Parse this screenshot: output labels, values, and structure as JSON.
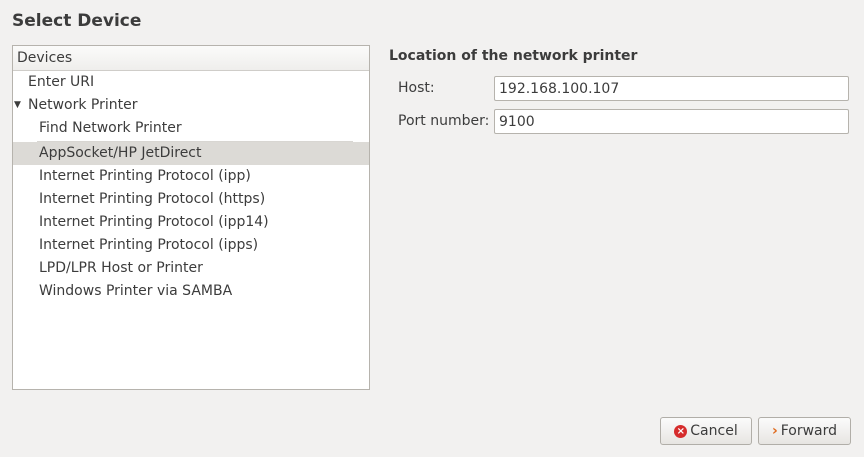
{
  "window": {
    "title": "Select Device"
  },
  "devices": {
    "header": "Devices",
    "items": [
      {
        "label": "Enter URI",
        "level": 0
      },
      {
        "label": "Network Printer",
        "level": 0,
        "expanded": true
      },
      {
        "label": "Find Network Printer",
        "level": 1
      },
      {
        "label": "AppSocket/HP JetDirect",
        "level": 1,
        "selected": true
      },
      {
        "label": "Internet Printing Protocol (ipp)",
        "level": 1
      },
      {
        "label": "Internet Printing Protocol (https)",
        "level": 1
      },
      {
        "label": "Internet Printing Protocol (ipp14)",
        "level": 1
      },
      {
        "label": "Internet Printing Protocol (ipps)",
        "level": 1
      },
      {
        "label": "LPD/LPR Host or Printer",
        "level": 1
      },
      {
        "label": "Windows Printer via SAMBA",
        "level": 1
      }
    ]
  },
  "details": {
    "section_title": "Location of the network printer",
    "host_label": "Host:",
    "host_value": "192.168.100.107",
    "port_label": "Port number:",
    "port_value": "9100"
  },
  "buttons": {
    "cancel_label": "Cancel",
    "forward_label": "Forward"
  },
  "icons": {
    "expander": "triangle-down-icon",
    "cancel": "cancel-icon",
    "forward": "forward-arrow-icon"
  },
  "colors": {
    "cancel_icon": "#d62c2c",
    "forward_icon": "#e06a1c",
    "selected_row": "#dcdad6"
  }
}
